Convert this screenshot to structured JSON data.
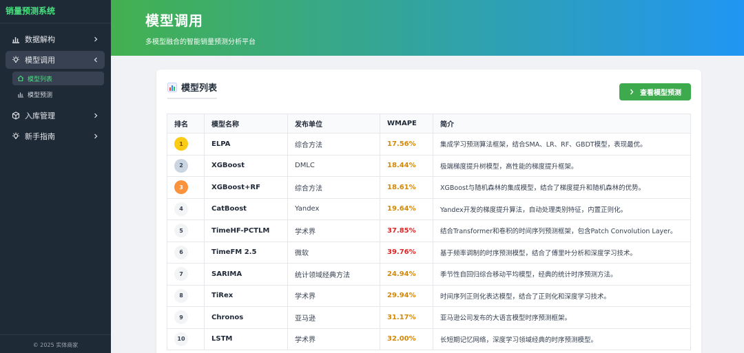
{
  "sidebar": {
    "brand": "销量预测系统",
    "items": [
      {
        "label": "数据解构",
        "icon": "bar-chart-icon"
      },
      {
        "label": "模型调用",
        "icon": "lightbulb-icon"
      },
      {
        "label": "入库管理",
        "icon": "box-icon"
      },
      {
        "label": "新手指南",
        "icon": "lightbulb-icon"
      }
    ],
    "subitems": [
      {
        "label": "模型列表",
        "icon": "home-icon"
      },
      {
        "label": "模型预测",
        "icon": "bar-chart-icon"
      }
    ],
    "footer": "© 2025 实体商家"
  },
  "header": {
    "title": "模型调用",
    "subtitle": "多模型融合的智能销量预测分析平台"
  },
  "card": {
    "title": "模型列表",
    "title_icon": "chart-emoji-icon",
    "button_label": "查看模型预测"
  },
  "table": {
    "headers": [
      "排名",
      "模型名称",
      "发布单位",
      "WMAPE",
      "简介"
    ],
    "rows": [
      {
        "rank": "1",
        "name": "ELPA",
        "org": "综合方法",
        "wmape": "17.56%",
        "desc": "集成学习预测算法框架，结合SMA、LR、RF、GBDT模型，表现最优。"
      },
      {
        "rank": "2",
        "name": "XGBoost",
        "org": "DMLC",
        "wmape": "18.44%",
        "desc": "极端梯度提升树模型，高性能的梯度提升框架。"
      },
      {
        "rank": "3",
        "name": "XGBoost+RF",
        "org": "综合方法",
        "wmape": "18.61%",
        "desc": "XGBoost与随机森林的集成模型，结合了梯度提升和随机森林的优势。"
      },
      {
        "rank": "4",
        "name": "CatBoost",
        "org": "Yandex",
        "wmape": "19.64%",
        "desc": "Yandex开发的梯度提升算法，自动处理类别特征，内置正则化。"
      },
      {
        "rank": "5",
        "name": "TimeHF-PCTLM",
        "org": "学术界",
        "wmape": "37.85%",
        "desc": "结合Transformer和卷积的时间序列预测框架，包含Patch Convolution Layer。"
      },
      {
        "rank": "6",
        "name": "TimeFM 2.5",
        "org": "微软",
        "wmape": "39.76%",
        "desc": "基于频率调制的时序预测模型，结合了傅里叶分析和深度学习技术。"
      },
      {
        "rank": "7",
        "name": "SARIMA",
        "org": "统计领域经典方法",
        "wmape": "24.94%",
        "desc": "季节性自回归综合移动平均模型，经典的统计时序预测方法。"
      },
      {
        "rank": "8",
        "name": "TiRex",
        "org": "学术界",
        "wmape": "29.94%",
        "desc": "时间序列正则化表达模型，结合了正则化和深度学习技术。"
      },
      {
        "rank": "9",
        "name": "Chronos",
        "org": "亚马逊",
        "wmape": "31.17%",
        "desc": "亚马逊公司发布的大语言模型时序预测框架。"
      },
      {
        "rank": "10",
        "name": "LSTM",
        "org": "学术界",
        "wmape": "32.00%",
        "desc": "长短期记忆网络，深度学习领域经典的时序预测模型。"
      }
    ]
  },
  "colors": {
    "brand_green": "#4ade80",
    "button_green": "#3daa4e",
    "header_gradient_start": "#43b14f",
    "header_gradient_end": "#2196f3",
    "wmape_gold": "#d48806",
    "wmape_red": "#dc2626"
  }
}
